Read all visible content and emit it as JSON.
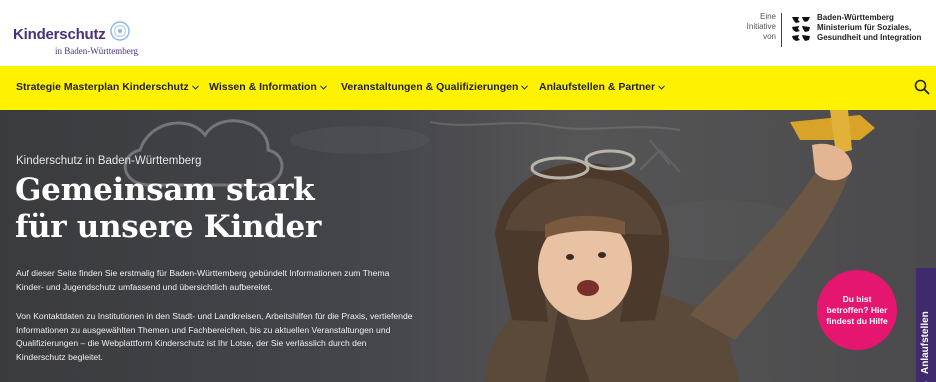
{
  "header": {
    "logo": {
      "title": "Kinderschutz",
      "subtitle": "in Baden-Württemberg"
    },
    "initiative": {
      "line1": "Eine",
      "line2": "Initiative",
      "line3": "von"
    },
    "ministry": {
      "line1": "Baden-Württemberg",
      "line2": "Ministerium für Soziales,",
      "line3": "Gesundheit und Integration"
    }
  },
  "nav": {
    "items": [
      {
        "label": "Strategie Masterplan Kinderschutz"
      },
      {
        "label": "Wissen & Information"
      },
      {
        "label": "Veranstaltungen & Qualifizierungen"
      },
      {
        "label": "Anlaufstellen & Partner"
      }
    ],
    "search_icon": "search-icon",
    "chevron_icon": "chevron-down-icon"
  },
  "hero": {
    "overline": "Kinderschutz in Baden-Württemberg",
    "title_line1": "Gemeinsam stark",
    "title_line2": "für unsere Kinder",
    "paragraph1": "Auf dieser Seite finden Sie erstmalig für Baden-Württemberg gebündelt Informationen zum Thema Kinder- und Jugendschutz umfassend und übersichtlich aufbereitet.",
    "paragraph2": "Von Kontaktdaten zu Institutionen in den Stadt- und Landkreisen, Arbeitshilfen für die Praxis, vertiefende Informationen zu ausgewählten Themen und Fachbereichen, bis zu aktuellen Veranstaltungen und Qualifizierungen – die Webplattform Kinderschutz ist Ihr Lotse, der Sie verlässlich durch den Kinderschutz begleitet.",
    "help_badge": "Du bist betroffen? Hier findest du Hilfe",
    "side_tab": "Anlaufstellen"
  },
  "colors": {
    "nav_background": "#fff200",
    "brand_purple": "#4a2f7c",
    "badge_pink": "#e5166f",
    "side_tab_purple": "#3f2a6e",
    "hero_background": "#45464a"
  }
}
